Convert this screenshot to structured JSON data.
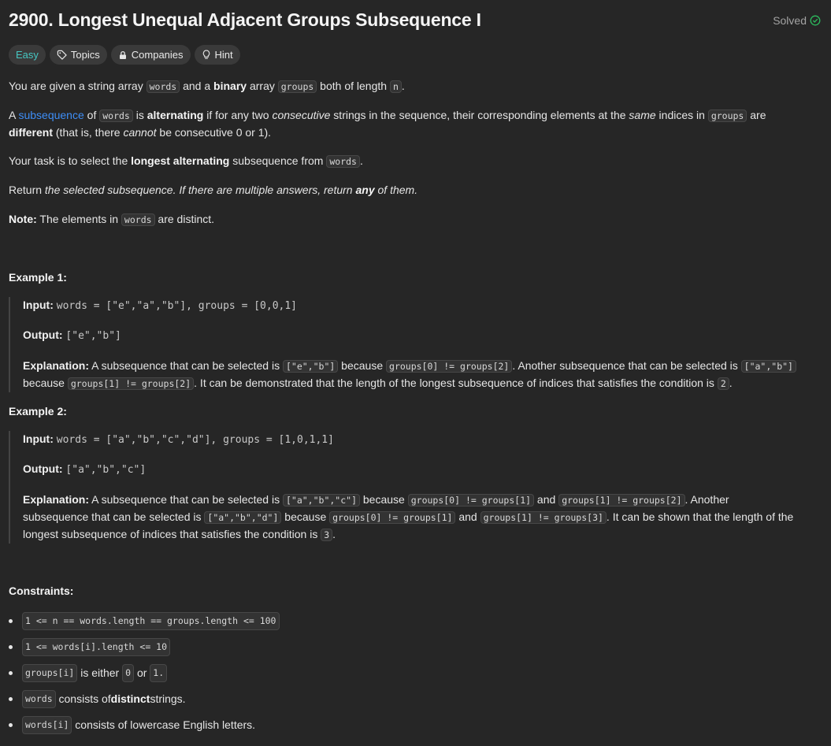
{
  "problem": {
    "title": "2900. Longest Unequal Adjacent Groups Subsequence I",
    "status": "Solved"
  },
  "tags": {
    "difficulty": "Easy",
    "topics": "Topics",
    "companies": "Companies",
    "hint": "Hint"
  },
  "description": {
    "p1": [
      "You are given a string array ",
      "words",
      " and a ",
      "binary",
      " array ",
      "groups",
      " both of length ",
      "n",
      "."
    ],
    "p2": [
      "A ",
      "subsequence",
      " of ",
      "words",
      " is ",
      "alternating",
      " if for any two ",
      "consecutive",
      " strings in the sequence, their corresponding elements at the ",
      "same",
      " indices in ",
      "groups",
      " are",
      "different",
      " (that is, there ",
      "cannot",
      " be consecutive 0 or 1)."
    ],
    "p3": [
      "Your task is to select the ",
      "longest alternating",
      " subsequence from ",
      "words",
      "."
    ],
    "p4": [
      "Return ",
      "the selected subsequence. If there are multiple answers, return ",
      "any",
      " of them."
    ],
    "p5": [
      "Note:",
      " The elements in ",
      "words",
      " are distinct."
    ]
  },
  "examples": [
    {
      "title": "Example 1:",
      "input_label": "Input:",
      "input": "words = [\"e\",\"a\",\"b\"], groups = [0,0,1]",
      "output_label": "Output:",
      "output": "[\"e\",\"b\"]",
      "explanation_label": "Explanation:",
      "exp": [
        "A subsequence that can be selected is ",
        "[\"e\",\"b\"]",
        " because ",
        "groups[0] != groups[2]",
        ". Another subsequence that can be selected is ",
        "[\"a\",\"b\"]",
        "because ",
        "groups[1] != groups[2]",
        ". It can be demonstrated that the length of the longest subsequence of indices that satisfies the condition is ",
        "2",
        "."
      ]
    },
    {
      "title": "Example 2:",
      "input_label": "Input:",
      "input": "words = [\"a\",\"b\",\"c\",\"d\"], groups = [1,0,1,1]",
      "output_label": "Output:",
      "output": "[\"a\",\"b\",\"c\"]",
      "explanation_label": "Explanation:",
      "exp": [
        "A subsequence that can be selected is ",
        "[\"a\",\"b\",\"c\"]",
        " because ",
        "groups[0] != groups[1]",
        " and ",
        "groups[1] != groups[2]",
        ". Another",
        "subsequence that can be selected is ",
        "[\"a\",\"b\",\"d\"]",
        " because ",
        "groups[0] != groups[1]",
        " and ",
        "groups[1] != groups[3]",
        ". It can be shown that the length of the",
        "longest subsequence of indices that satisfies the condition is ",
        "3",
        "."
      ]
    }
  ],
  "constraints": {
    "title": "Constraints:",
    "c1": "1 <= n == words.length == groups.length <= 100",
    "c2": "1 <= words[i].length <= 10",
    "c3": [
      "groups[i]",
      " is either ",
      "0",
      " or ",
      "1."
    ],
    "c4": [
      "words",
      " consists of ",
      "distinct",
      " strings."
    ],
    "c5": [
      "words[i]",
      " consists of lowercase English letters."
    ]
  },
  "colors": {
    "easy": "#46c6c2",
    "link": "#3e8ef7",
    "solved_check": "#2cbb5d",
    "background": "#262626"
  },
  "icons": {
    "topics": "tag-icon",
    "companies": "lock-icon",
    "hint": "lightbulb-icon",
    "solved": "check-circle-icon"
  }
}
